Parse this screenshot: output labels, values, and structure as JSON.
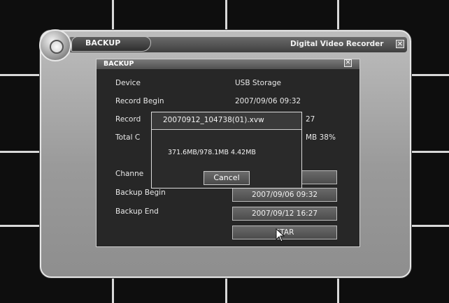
{
  "window": {
    "title": "BACKUP",
    "brand": "Digital Video Recorder",
    "close_glyph": "✕"
  },
  "panel": {
    "title": "BACKUP",
    "close_glyph": "✕"
  },
  "info": {
    "device_label": "Device",
    "device_value": "USB Storage",
    "record_begin_label": "Record Begin",
    "record_begin_value": "2007/09/06 09:32",
    "record_end_label_visible": "Record",
    "record_end_value_visible": "27",
    "total_label_visible": "Total C",
    "total_value_visible": "MB 38%"
  },
  "backup": {
    "channel_label_visible": "Channe",
    "begin_label_visible": "Backup Begin",
    "begin_value": "2007/09/06 09:32",
    "end_label": "Backup End",
    "end_value": "2007/09/12 16:27",
    "start_label": "STAR"
  },
  "popup": {
    "filename": "20070912_104738(01).xvw",
    "progress": "371.6MB/978.1MB 4.42MB",
    "cancel_label": "Cancel"
  },
  "icons": {
    "logo": "disc-logo-icon",
    "close": "close-icon",
    "cursor": "mouse-pointer-icon"
  },
  "colors": {
    "panel_bg": "#272727",
    "window_frame": "#a8a8a8",
    "grid_lines": "#d8d8d8"
  }
}
